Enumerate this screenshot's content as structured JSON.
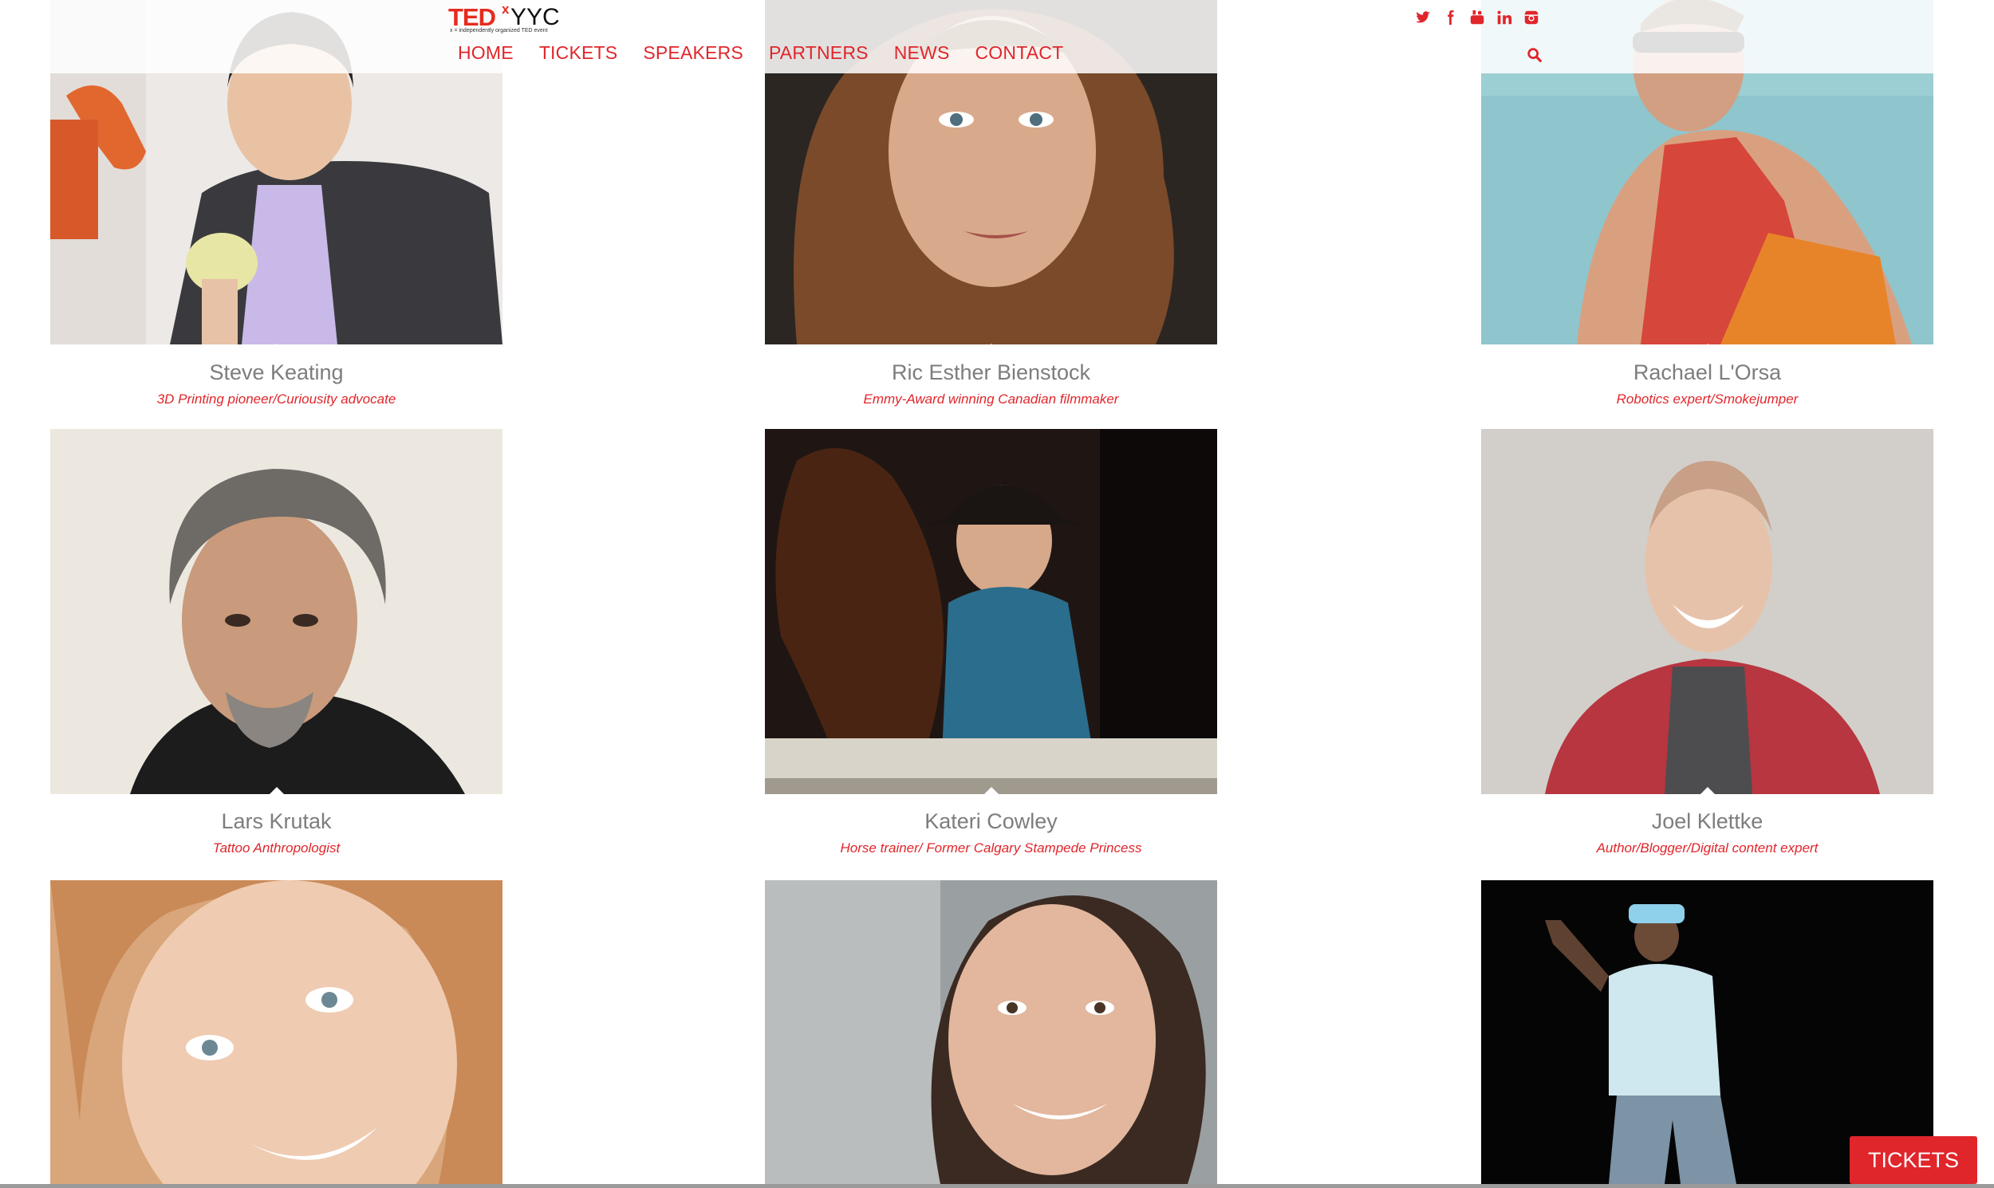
{
  "header": {
    "logo_ted": "TED",
    "logo_x": "x",
    "logo_yyc": "YYC",
    "logo_tagline": "x = independently organized TED event",
    "nav": [
      "HOME",
      "TICKETS",
      "SPEAKERS",
      "PARTNERS",
      "NEWS",
      "CONTACT"
    ],
    "social_icons": [
      "twitter-icon",
      "facebook-icon",
      "youtube-icon",
      "linkedin-icon",
      "instagram-icon"
    ],
    "accent_color": "#e0262b"
  },
  "speakers": [
    {
      "name": "Steve Keating",
      "role": "3D Printing pioneer/Curiousity advocate"
    },
    {
      "name": "Ric Esther Bienstock",
      "role": "Emmy-Award winning Canadian filmmaker"
    },
    {
      "name": "Rachael L'Orsa",
      "role": "Robotics expert/Smokejumper"
    },
    {
      "name": "Lars Krutak",
      "role": "Tattoo Anthropologist"
    },
    {
      "name": "Kateri Cowley",
      "role": "Horse trainer/ Former Calgary Stampede Princess"
    },
    {
      "name": "Joel Klettke",
      "role": "Author/Blogger/Digital content expert"
    },
    {
      "name": "",
      "role": ""
    },
    {
      "name": "",
      "role": ""
    },
    {
      "name": "",
      "role": ""
    }
  ],
  "floating_button": {
    "label": "TICKETS"
  }
}
